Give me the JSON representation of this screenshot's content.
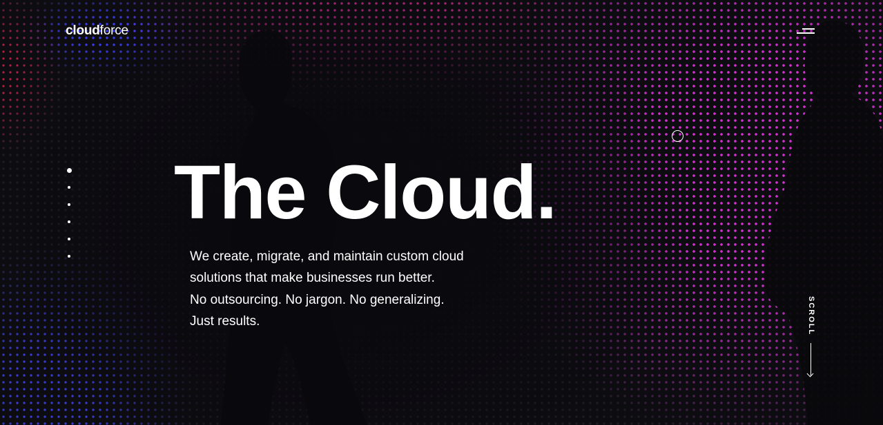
{
  "brand": {
    "logo_bold": "cloud",
    "logo_light": "force"
  },
  "header": {
    "menu_icon": "hamburger-menu-icon"
  },
  "pager": {
    "count": 6,
    "active_index": 0
  },
  "hero": {
    "headline": "The Cloud.",
    "tagline_lines": [
      "We create, migrate, and maintain custom cloud",
      "solutions that make businesses run better.",
      "No outsourcing. No jargon. No generalizing.",
      "Just results."
    ]
  },
  "scroll": {
    "label": "SCROLL",
    "icon": "arrow-down-icon"
  },
  "colors": {
    "background": "#0d0c11",
    "accent_magenta": "#d42fd0",
    "accent_pink": "#e02a9a",
    "accent_blue": "#3a3cf0",
    "text": "#ffffff"
  }
}
